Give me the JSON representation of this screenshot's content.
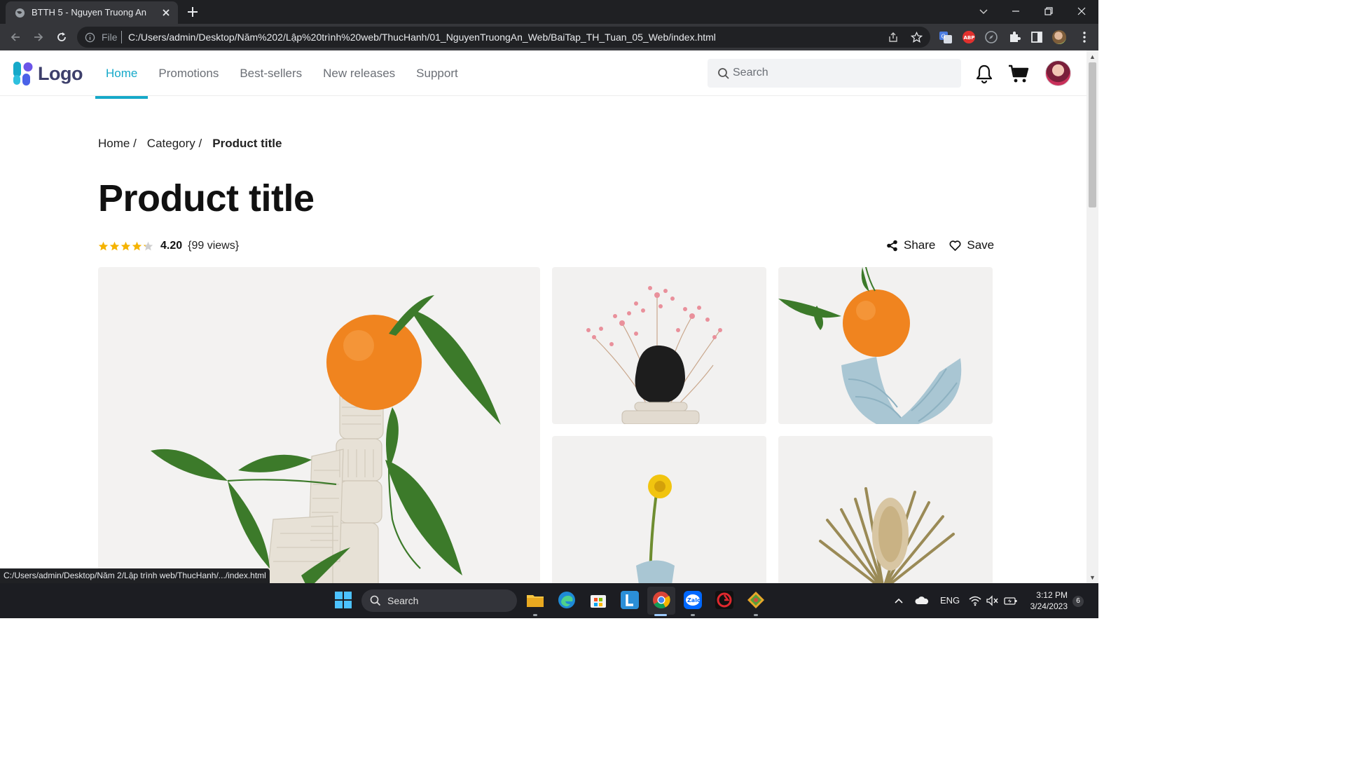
{
  "browser": {
    "tab_title": "BTTH 5 - Nguyen Truong An",
    "address_scheme_label": "File",
    "address_url": "C:/Users/admin/Desktop/Năm%202/Lập%20trình%20web/ThucHanh/01_NguyenTruongAn_Web/BaiTap_TH_Tuan_05_Web/index.html",
    "status_url": "C:/Users/admin/Desktop/Năm 2/Lập trình web/ThucHanh/.../index.html"
  },
  "site": {
    "logo_text": "Logo",
    "nav": [
      {
        "label": "Home",
        "active": true
      },
      {
        "label": "Promotions",
        "active": false
      },
      {
        "label": "Best-sellers",
        "active": false
      },
      {
        "label": "New releases",
        "active": false
      },
      {
        "label": "Support",
        "active": false
      }
    ],
    "search_placeholder": "Search",
    "accent_color": "#16a9c9"
  },
  "breadcrumb": {
    "items": [
      "Home /",
      "Category /"
    ],
    "current": "Product title"
  },
  "product": {
    "title": "Product title",
    "rating": 4.2,
    "rating_label": "4.20",
    "views_label": "{99 views}",
    "share_label": "Share",
    "save_label": "Save"
  },
  "gallery": [
    {
      "name": "orange-on-clay-sculpture-image",
      "subject": "orange"
    },
    {
      "name": "pink-dried-flowers-image",
      "subject": "pink-flowers"
    },
    {
      "name": "orange-on-blue-vase-image",
      "subject": "orange-blue"
    },
    {
      "name": "yellow-flower-image",
      "subject": "yellow-flower"
    },
    {
      "name": "dried-banksia-image",
      "subject": "banksia"
    }
  ],
  "taskbar": {
    "search_label": "Search",
    "language": "ENG",
    "time": "3:12 PM",
    "date": "3/24/2023",
    "notification_count": "6"
  }
}
